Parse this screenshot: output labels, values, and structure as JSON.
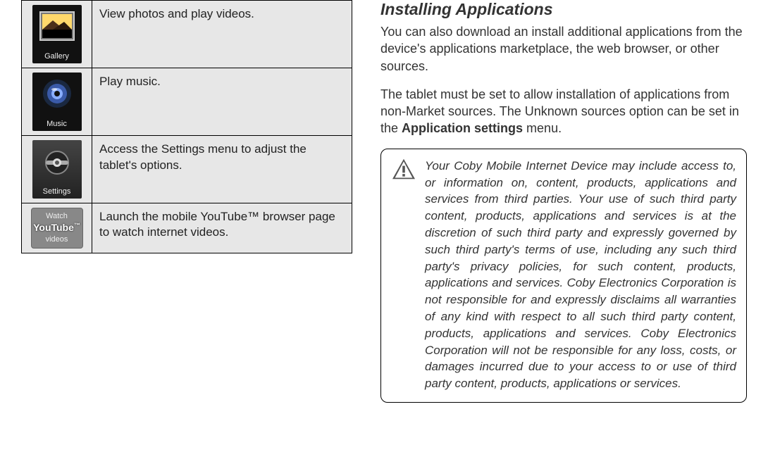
{
  "table": {
    "rows": [
      {
        "icon_label": "Gallery",
        "desc": "View photos and play videos."
      },
      {
        "icon_label": "Music",
        "desc": "Play music."
      },
      {
        "icon_label": "Settings",
        "desc": "Access the Settings menu to adjust the tablet's options."
      },
      {
        "icon_label_top": "Watch",
        "icon_label_mid": "YouTube",
        "icon_label_bot": "videos",
        "desc": "Launch the mobile YouTube™ browser page to watch internet videos."
      }
    ]
  },
  "heading": "Installing Applications",
  "para1": "You can also download an install additional applications from the device's applications marketplace, the web browser, or other sources.",
  "para2_pre": "The tablet must be set to allow installation of applications from non-Market sources. The Unknown sources option can be set in the ",
  "para2_bold": "Application settings",
  "para2_post": " menu.",
  "callout": "Your Coby Mobile Internet Device may include access to, or information on, content, products, applications and services from third parties. Your use of such third party content, products, applications and services is at the discretion of such third party and expressly governed by such third party's terms of use, including any such third party's privacy policies, for such content, products, applications and services. Coby Electronics Corporation is not responsible for and expressly disclaims all warranties of any kind with respect to all such third party content, products, applications and services. Coby Electronics Corporation will not be responsible for any loss, costs, or damages incurred due to your access to or use of third party content, products, applications or services."
}
